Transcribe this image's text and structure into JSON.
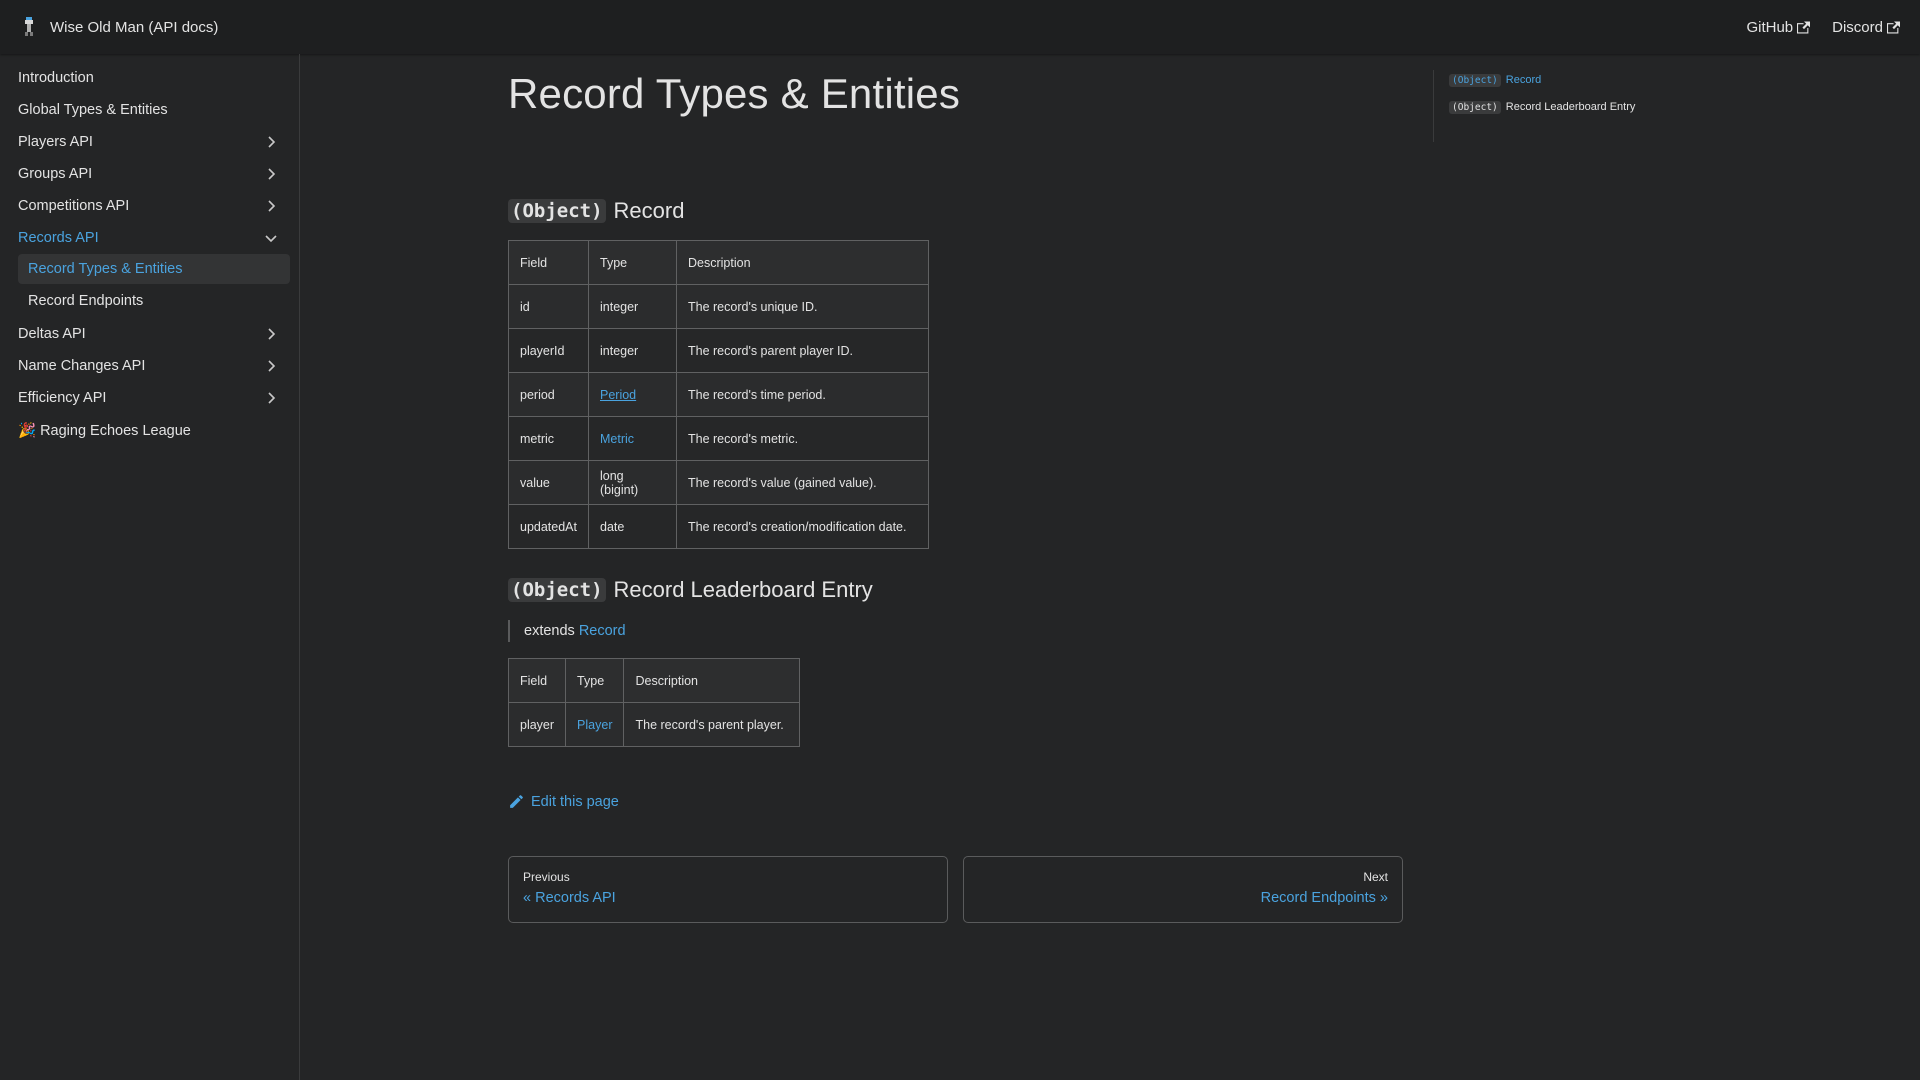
{
  "navbar": {
    "title": "Wise Old Man (API docs)",
    "links": [
      {
        "label": "GitHub",
        "icon": "external-link-icon"
      },
      {
        "label": "Discord",
        "icon": "external-link-icon"
      }
    ]
  },
  "sidebar": {
    "items": [
      {
        "label": "Introduction"
      },
      {
        "label": "Global Types & Entities"
      },
      {
        "label": "Players API",
        "icon": "chevron-right-icon"
      },
      {
        "label": "Groups API",
        "icon": "chevron-right-icon"
      },
      {
        "label": "Competitions API",
        "icon": "chevron-right-icon"
      },
      {
        "label": "Records API",
        "icon": "chevron-down-icon"
      },
      {
        "label": "Deltas API",
        "icon": "chevron-right-icon"
      },
      {
        "label": "Name Changes API",
        "icon": "chevron-right-icon"
      },
      {
        "label": "Efficiency API",
        "icon": "chevron-right-icon"
      },
      {
        "label": "🎉 Raging Echoes League"
      }
    ],
    "sub_items": [
      {
        "label": "Record Types & Entities"
      },
      {
        "label": "Record Endpoints"
      }
    ]
  },
  "main": {
    "title": "Record Types & Entities",
    "sections": [
      {
        "chip": "(Object)",
        "heading": "Record",
        "table": {
          "headers": [
            "Field",
            "Type",
            "Description"
          ],
          "rows": [
            [
              "id",
              "integer",
              "The record's unique ID."
            ],
            [
              "playerId",
              "integer",
              "The record's parent player ID."
            ],
            [
              "period",
              "Period",
              "The record's time period."
            ],
            [
              "metric",
              "Metric",
              "The record's metric."
            ],
            [
              "value",
              "long (bigint)",
              "The record's value (gained value)."
            ],
            [
              "updatedAt",
              "date",
              "The record's creation/modification date."
            ]
          ]
        }
      },
      {
        "chip": "(Object)",
        "heading": "Record Leaderboard Entry",
        "extends_prefix": "extends",
        "extends_link": "Record",
        "table": {
          "headers": [
            "Field",
            "Type",
            "Description"
          ],
          "rows": [
            [
              "player",
              "Player",
              "The record's parent player."
            ]
          ]
        }
      }
    ],
    "edit_label": "Edit this page",
    "pager": {
      "prev_sub": "Previous",
      "prev_label": "« Records API",
      "next_sub": "Next",
      "next_label": "Record Endpoints »"
    }
  },
  "toc": [
    {
      "chip": "(Object)",
      "label": "Record"
    },
    {
      "chip": "(Object)",
      "label": "Record Leaderboard Entry"
    }
  ],
  "colors": {
    "accent": "#4aa3df",
    "background": "#242526",
    "navbar": "#1e1f20"
  }
}
